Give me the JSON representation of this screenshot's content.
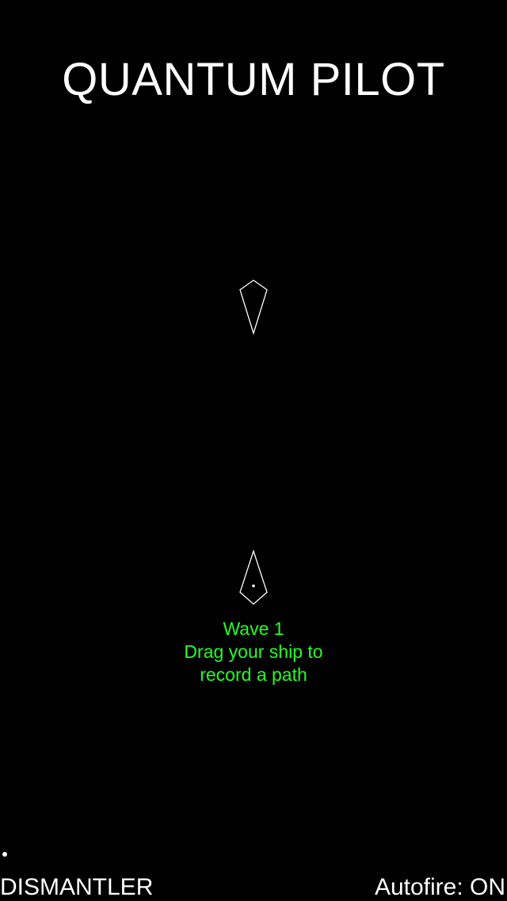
{
  "game": {
    "title": "QUANTUM PILOT"
  },
  "message": {
    "wave": "Wave 1",
    "line1": "Drag your ship to",
    "line2": "record a path"
  },
  "hud": {
    "left_label": "DISMANTLER",
    "right_label": "Autofire: ON"
  },
  "colors": {
    "background": "#000000",
    "text": "#ffffff",
    "message": "#22ff22",
    "ship_outline": "#ffffff"
  },
  "sprites": {
    "enemy_ship": "kite-ship-pointing-down",
    "player_ship": "kite-ship-pointing-up"
  }
}
